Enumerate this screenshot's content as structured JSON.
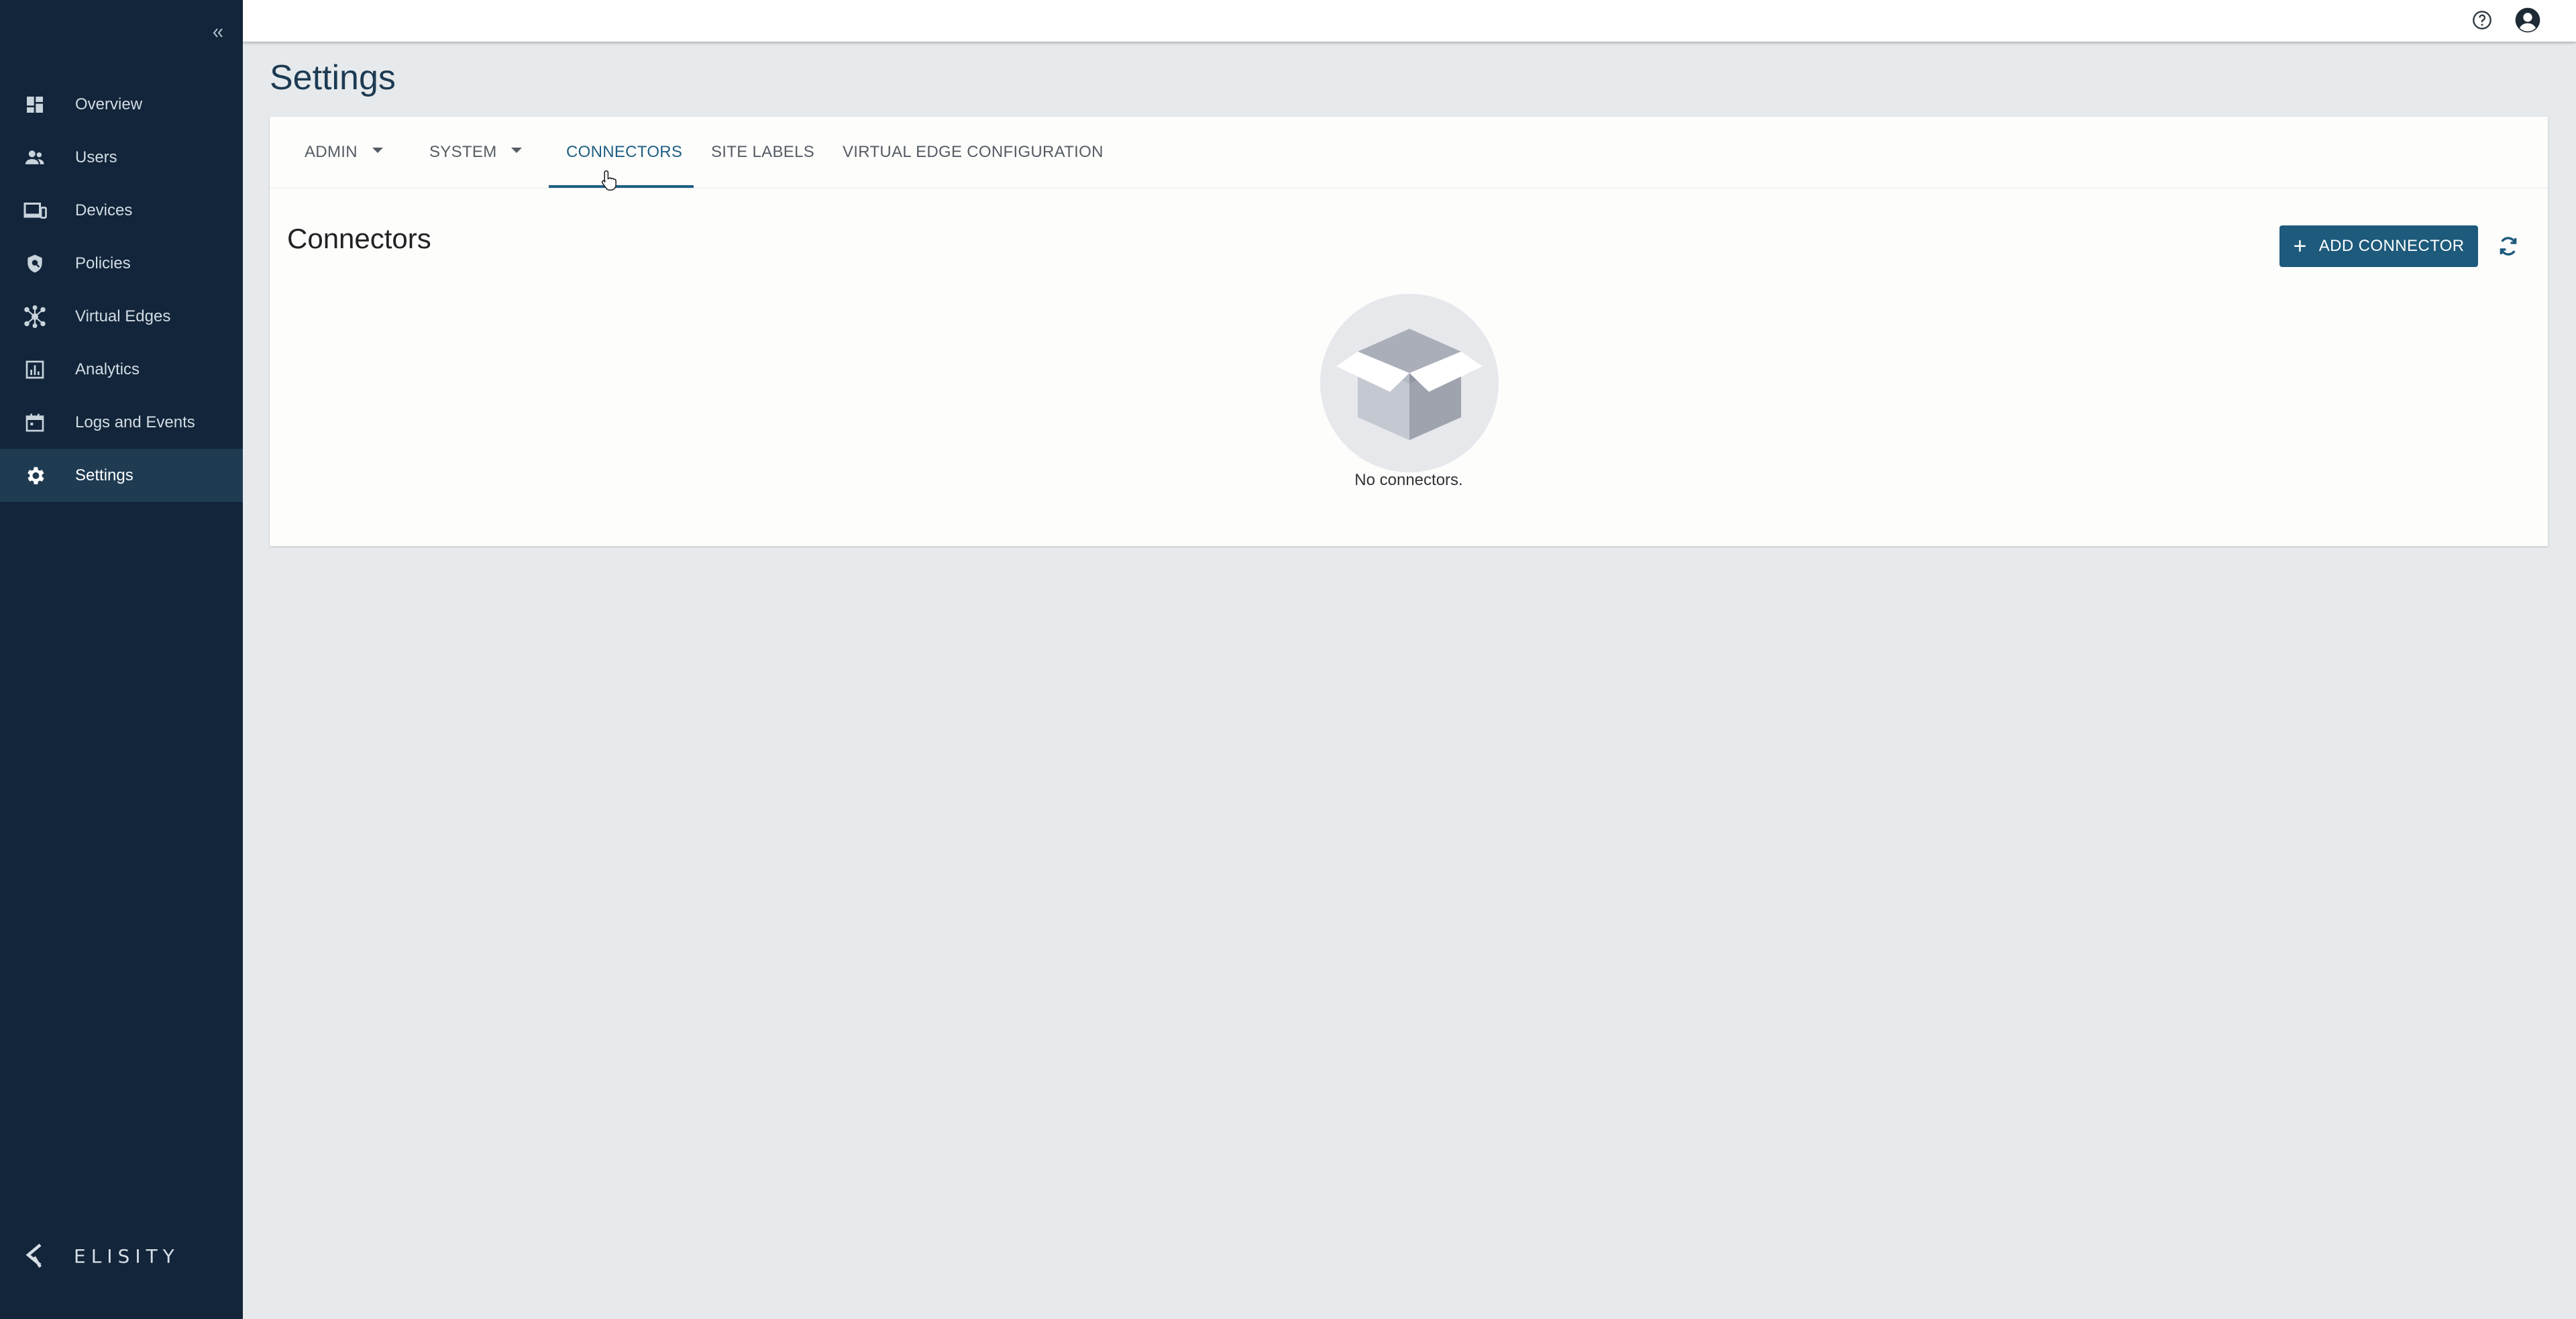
{
  "sidebar": {
    "collapse_icon": "double-chevron-left-icon",
    "items": [
      {
        "label": "Overview",
        "icon": "dashboard-icon"
      },
      {
        "label": "Users",
        "icon": "users-icon"
      },
      {
        "label": "Devices",
        "icon": "devices-icon"
      },
      {
        "label": "Policies",
        "icon": "shield-icon"
      },
      {
        "label": "Virtual Edges",
        "icon": "network-icon"
      },
      {
        "label": "Analytics",
        "icon": "analytics-icon"
      },
      {
        "label": "Logs and Events",
        "icon": "calendar-icon"
      },
      {
        "label": "Settings",
        "icon": "gear-icon",
        "active": true
      }
    ],
    "logo_text": "ELISITY"
  },
  "topbar": {
    "help_icon": "help-icon",
    "account_icon": "account-icon"
  },
  "page": {
    "title": "Settings"
  },
  "tabs": [
    {
      "label": "ADMIN"
    },
    {
      "label": "SYSTEM"
    },
    {
      "label": "CONNECTORS",
      "active": true
    },
    {
      "label": "SITE LABELS"
    },
    {
      "label": "VIRTUAL EDGE CONFIGURATION"
    }
  ],
  "connectors": {
    "title": "Connectors",
    "add_button_label": "ADD CONNECTOR",
    "empty_text": "No connectors."
  },
  "colors": {
    "sidebar_bg": "#12253a",
    "sidebar_active": "#1f3b52",
    "accent": "#1d5a7b",
    "page_bg": "#e7eaec"
  }
}
